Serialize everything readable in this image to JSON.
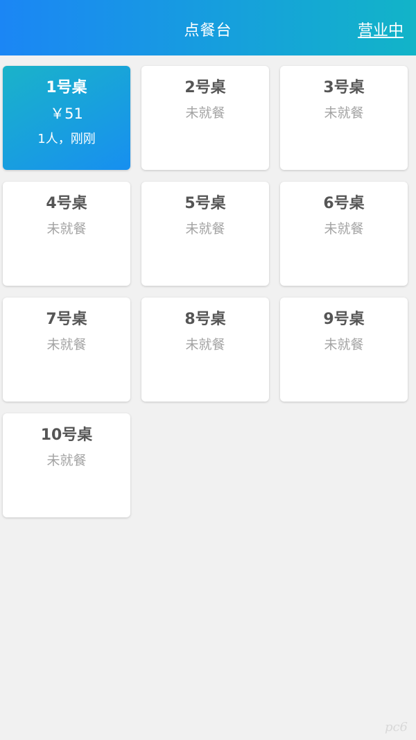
{
  "header": {
    "title": "点餐台",
    "status_label": "营业中"
  },
  "tables": [
    {
      "name": "1号桌",
      "amount": "￥51",
      "detail": "1人，刚刚",
      "active": true
    },
    {
      "name": "2号桌",
      "status": "未就餐"
    },
    {
      "name": "3号桌",
      "status": "未就餐"
    },
    {
      "name": "4号桌",
      "status": "未就餐"
    },
    {
      "name": "5号桌",
      "status": "未就餐"
    },
    {
      "name": "6号桌",
      "status": "未就餐"
    },
    {
      "name": "7号桌",
      "status": "未就餐"
    },
    {
      "name": "8号桌",
      "status": "未就餐"
    },
    {
      "name": "9号桌",
      "status": "未就餐"
    },
    {
      "name": "10号桌",
      "status": "未就餐"
    }
  ],
  "watermark": "pc6",
  "colors": {
    "header_gradient_start": "#1b86f5",
    "header_gradient_end": "#12b4c8",
    "active_card_start": "#1ab3c9",
    "active_card_end": "#178ff0",
    "background": "#f1f1f1"
  }
}
